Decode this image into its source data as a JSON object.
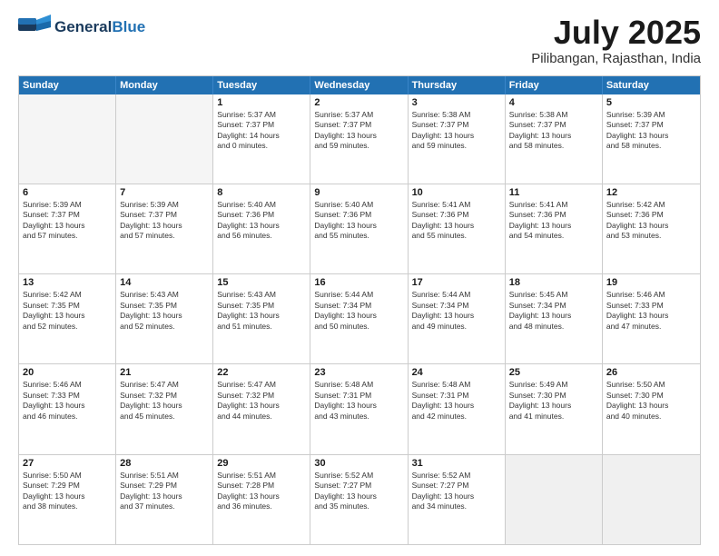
{
  "header": {
    "logo": {
      "general": "General",
      "blue": "Blue"
    },
    "title": "July 2025",
    "location": "Pilibangan, Rajasthan, India"
  },
  "calendar": {
    "days_of_week": [
      "Sunday",
      "Monday",
      "Tuesday",
      "Wednesday",
      "Thursday",
      "Friday",
      "Saturday"
    ],
    "weeks": [
      [
        {
          "day": "",
          "info": "",
          "empty": true
        },
        {
          "day": "",
          "info": "",
          "empty": true
        },
        {
          "day": "1",
          "info": "Sunrise: 5:37 AM\nSunset: 7:37 PM\nDaylight: 14 hours\nand 0 minutes."
        },
        {
          "day": "2",
          "info": "Sunrise: 5:37 AM\nSunset: 7:37 PM\nDaylight: 13 hours\nand 59 minutes."
        },
        {
          "day": "3",
          "info": "Sunrise: 5:38 AM\nSunset: 7:37 PM\nDaylight: 13 hours\nand 59 minutes."
        },
        {
          "day": "4",
          "info": "Sunrise: 5:38 AM\nSunset: 7:37 PM\nDaylight: 13 hours\nand 58 minutes."
        },
        {
          "day": "5",
          "info": "Sunrise: 5:39 AM\nSunset: 7:37 PM\nDaylight: 13 hours\nand 58 minutes."
        }
      ],
      [
        {
          "day": "6",
          "info": "Sunrise: 5:39 AM\nSunset: 7:37 PM\nDaylight: 13 hours\nand 57 minutes."
        },
        {
          "day": "7",
          "info": "Sunrise: 5:39 AM\nSunset: 7:37 PM\nDaylight: 13 hours\nand 57 minutes."
        },
        {
          "day": "8",
          "info": "Sunrise: 5:40 AM\nSunset: 7:36 PM\nDaylight: 13 hours\nand 56 minutes."
        },
        {
          "day": "9",
          "info": "Sunrise: 5:40 AM\nSunset: 7:36 PM\nDaylight: 13 hours\nand 55 minutes."
        },
        {
          "day": "10",
          "info": "Sunrise: 5:41 AM\nSunset: 7:36 PM\nDaylight: 13 hours\nand 55 minutes."
        },
        {
          "day": "11",
          "info": "Sunrise: 5:41 AM\nSunset: 7:36 PM\nDaylight: 13 hours\nand 54 minutes."
        },
        {
          "day": "12",
          "info": "Sunrise: 5:42 AM\nSunset: 7:36 PM\nDaylight: 13 hours\nand 53 minutes."
        }
      ],
      [
        {
          "day": "13",
          "info": "Sunrise: 5:42 AM\nSunset: 7:35 PM\nDaylight: 13 hours\nand 52 minutes."
        },
        {
          "day": "14",
          "info": "Sunrise: 5:43 AM\nSunset: 7:35 PM\nDaylight: 13 hours\nand 52 minutes."
        },
        {
          "day": "15",
          "info": "Sunrise: 5:43 AM\nSunset: 7:35 PM\nDaylight: 13 hours\nand 51 minutes."
        },
        {
          "day": "16",
          "info": "Sunrise: 5:44 AM\nSunset: 7:34 PM\nDaylight: 13 hours\nand 50 minutes."
        },
        {
          "day": "17",
          "info": "Sunrise: 5:44 AM\nSunset: 7:34 PM\nDaylight: 13 hours\nand 49 minutes."
        },
        {
          "day": "18",
          "info": "Sunrise: 5:45 AM\nSunset: 7:34 PM\nDaylight: 13 hours\nand 48 minutes."
        },
        {
          "day": "19",
          "info": "Sunrise: 5:46 AM\nSunset: 7:33 PM\nDaylight: 13 hours\nand 47 minutes."
        }
      ],
      [
        {
          "day": "20",
          "info": "Sunrise: 5:46 AM\nSunset: 7:33 PM\nDaylight: 13 hours\nand 46 minutes."
        },
        {
          "day": "21",
          "info": "Sunrise: 5:47 AM\nSunset: 7:32 PM\nDaylight: 13 hours\nand 45 minutes."
        },
        {
          "day": "22",
          "info": "Sunrise: 5:47 AM\nSunset: 7:32 PM\nDaylight: 13 hours\nand 44 minutes."
        },
        {
          "day": "23",
          "info": "Sunrise: 5:48 AM\nSunset: 7:31 PM\nDaylight: 13 hours\nand 43 minutes."
        },
        {
          "day": "24",
          "info": "Sunrise: 5:48 AM\nSunset: 7:31 PM\nDaylight: 13 hours\nand 42 minutes."
        },
        {
          "day": "25",
          "info": "Sunrise: 5:49 AM\nSunset: 7:30 PM\nDaylight: 13 hours\nand 41 minutes."
        },
        {
          "day": "26",
          "info": "Sunrise: 5:50 AM\nSunset: 7:30 PM\nDaylight: 13 hours\nand 40 minutes."
        }
      ],
      [
        {
          "day": "27",
          "info": "Sunrise: 5:50 AM\nSunset: 7:29 PM\nDaylight: 13 hours\nand 38 minutes."
        },
        {
          "day": "28",
          "info": "Sunrise: 5:51 AM\nSunset: 7:29 PM\nDaylight: 13 hours\nand 37 minutes."
        },
        {
          "day": "29",
          "info": "Sunrise: 5:51 AM\nSunset: 7:28 PM\nDaylight: 13 hours\nand 36 minutes."
        },
        {
          "day": "30",
          "info": "Sunrise: 5:52 AM\nSunset: 7:27 PM\nDaylight: 13 hours\nand 35 minutes."
        },
        {
          "day": "31",
          "info": "Sunrise: 5:52 AM\nSunset: 7:27 PM\nDaylight: 13 hours\nand 34 minutes."
        },
        {
          "day": "",
          "info": "",
          "empty": true
        },
        {
          "day": "",
          "info": "",
          "empty": true
        }
      ]
    ]
  }
}
